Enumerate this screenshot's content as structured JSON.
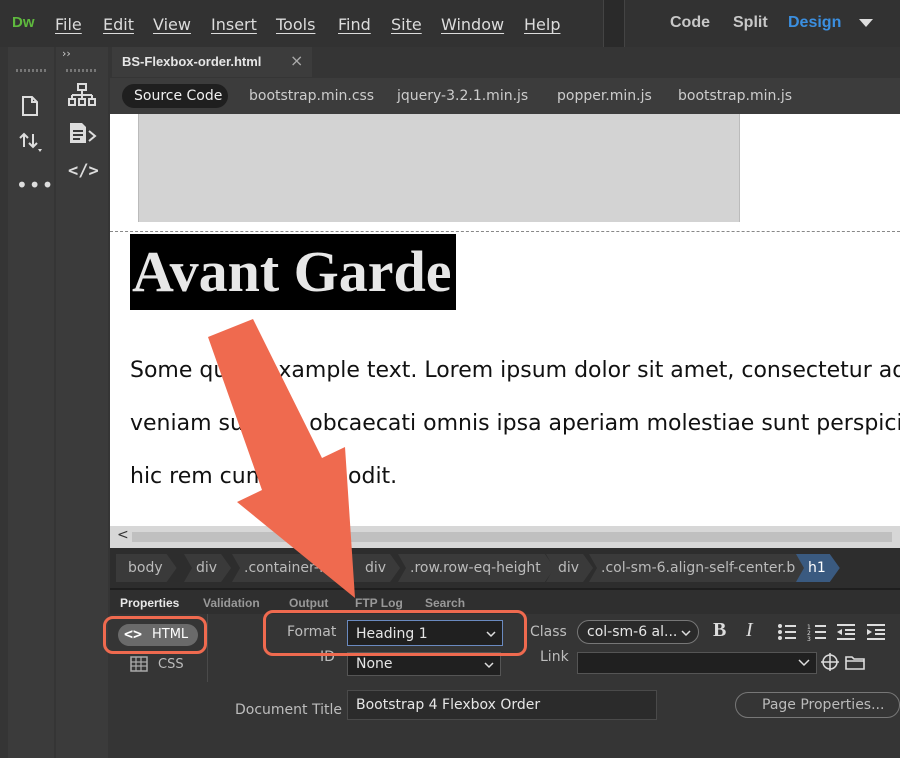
{
  "app": {
    "logo": "Dw"
  },
  "menu": [
    "File",
    "Edit",
    "View",
    "Insert",
    "Tools",
    "Find",
    "Site",
    "Window",
    "Help"
  ],
  "views": {
    "code": "Code",
    "split": "Split",
    "design": "Design"
  },
  "document": {
    "tab_name": "BS-Flexbox-order.html",
    "close": "×"
  },
  "related_files": [
    "Source Code",
    "bootstrap.min.css",
    "jquery-3.2.1.min.js",
    "popper.min.js",
    "bootstrap.min.js"
  ],
  "design_view": {
    "heading": "Avant Garde",
    "paragraph_lines": [
      "Some quick example text. Lorem ipsum dolor sit amet, consectetur adi",
      "veniam suscipit obcaecati omnis ipsa aperiam molestiae sunt perspicia",
      "hic rem cum minus odit."
    ]
  },
  "tag_selector": [
    "body",
    "div",
    ".container-fluid",
    "div",
    ".row.row-eq-height",
    "div",
    ".col-sm-6.align-self-center.b",
    "h1"
  ],
  "properties": {
    "tabs": [
      "Properties",
      "Validation",
      "Output",
      "FTP Log",
      "Search"
    ],
    "html_button": "HTML",
    "css_button": "CSS",
    "format_label": "Format",
    "format_value": "Heading 1",
    "id_label": "ID",
    "id_value": "None",
    "class_label": "Class",
    "class_value": "col-sm-6 al...",
    "link_label": "Link",
    "link_value": "",
    "doc_title_label": "Document Title",
    "doc_title_value": "Bootstrap 4 Flexbox Order",
    "page_properties": "Page Properties..."
  },
  "colors": {
    "accent": "#3b8fe0",
    "callout": "#ef6a4f",
    "tag_active": "#3a5a80",
    "logo": "#5fb93e"
  }
}
